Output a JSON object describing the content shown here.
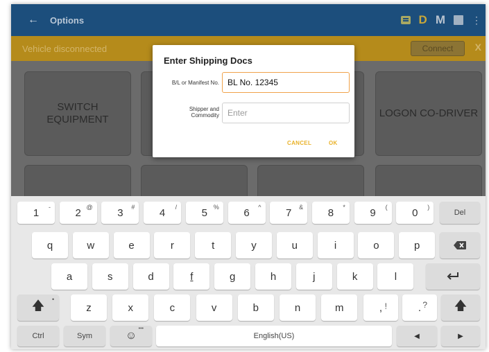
{
  "appbar": {
    "back_icon": "arrow-left-icon",
    "title": "Options",
    "d_label": "D",
    "m_label": "M"
  },
  "status": {
    "text": "Vehicle disconnected",
    "connect_label": "Connect",
    "close_label": "X"
  },
  "tiles": {
    "switch_equipment": "SWITCH EQUIPMENT",
    "logon_codriver": "LOGON CO-DRIVER"
  },
  "dialog": {
    "title": "Enter Shipping Docs",
    "bl_label": "B/L or Manifest No.",
    "bl_value": "BL No. 12345",
    "shipper_label_1": "Shipper and",
    "shipper_label_2": "Commodity",
    "shipper_placeholder": "Enter",
    "cancel_label": "CANCEL",
    "ok_label": "OK"
  },
  "keyboard": {
    "row1": [
      {
        "k": "1",
        "s": "-"
      },
      {
        "k": "2",
        "s": "@"
      },
      {
        "k": "3",
        "s": "#"
      },
      {
        "k": "4",
        "s": "/"
      },
      {
        "k": "5",
        "s": "%"
      },
      {
        "k": "6",
        "s": "^"
      },
      {
        "k": "7",
        "s": "&"
      },
      {
        "k": "8",
        "s": "*"
      },
      {
        "k": "9",
        "s": "("
      },
      {
        "k": "0",
        "s": ")"
      }
    ],
    "del_label": "Del",
    "row2": [
      "q",
      "w",
      "e",
      "r",
      "t",
      "y",
      "u",
      "i",
      "o",
      "p"
    ],
    "row3": [
      "a",
      "s",
      "d",
      "f",
      "g",
      "h",
      "j",
      "k",
      "l"
    ],
    "row4": [
      "z",
      "x",
      "c",
      "v",
      "b",
      "n",
      "m"
    ],
    "comma_key": ",",
    "comma_sup": "!",
    "period_key": ".",
    "period_sup": "?",
    "ctrl_label": "Ctrl",
    "sym_label": "Sym",
    "space_label": "English(US)"
  }
}
